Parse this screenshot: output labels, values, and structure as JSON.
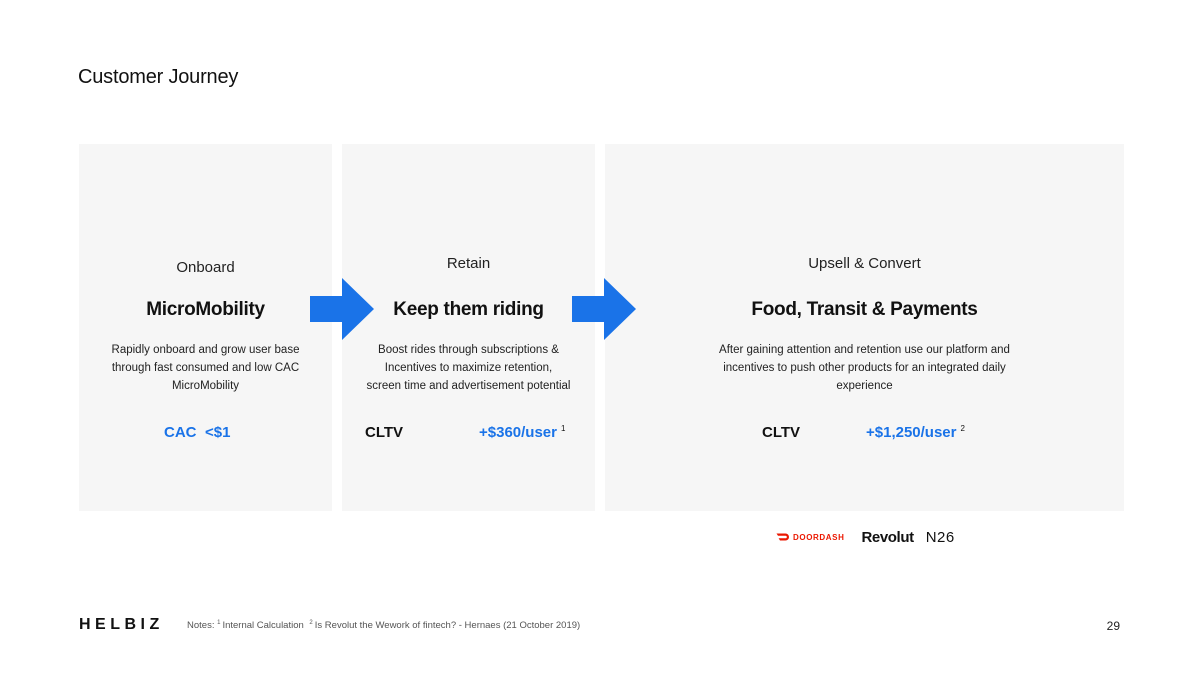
{
  "title": "Customer Journey",
  "colors": {
    "accent": "#1a73e8",
    "card_bg": "#f6f6f6",
    "doordash_red": "#eb1700"
  },
  "cards": [
    {
      "stage": "Onboard",
      "heading": "MicroMobility",
      "description": "Rapidly onboard and grow user base through fast consumed and low CAC MicroMobility",
      "metric_label": "CAC",
      "metric_value": "<$1",
      "footnote": ""
    },
    {
      "stage": "Retain",
      "heading": "Keep them riding",
      "description": "Boost rides through subscriptions & Incentives to maximize retention, screen time and advertisement potential",
      "metric_label": "CLTV",
      "metric_value": "+$360/user",
      "footnote": "1"
    },
    {
      "stage": "Upsell & Convert",
      "heading": "Food, Transit & Payments",
      "description": "After gaining attention and retention use our platform and incentives to push other products for an integrated daily experience",
      "metric_label": "CLTV",
      "metric_value": "+$1,250/user",
      "footnote": "2"
    }
  ],
  "arrows": {
    "icon": "arrow-right-icon",
    "color": "#1a73e8"
  },
  "partners": {
    "doordash": "DOORDASH",
    "revolut": "Revolut",
    "n26": "N26"
  },
  "footer": {
    "brand": "HELBIZ",
    "notes_prefix": "Notes:",
    "note1_mark": "1",
    "note1_text": "Internal Calculation",
    "note2_mark": "2",
    "note2_text": "Is Revolut the Wework of fintech? - Hernaes (21 October 2019)",
    "page_number": "29"
  }
}
